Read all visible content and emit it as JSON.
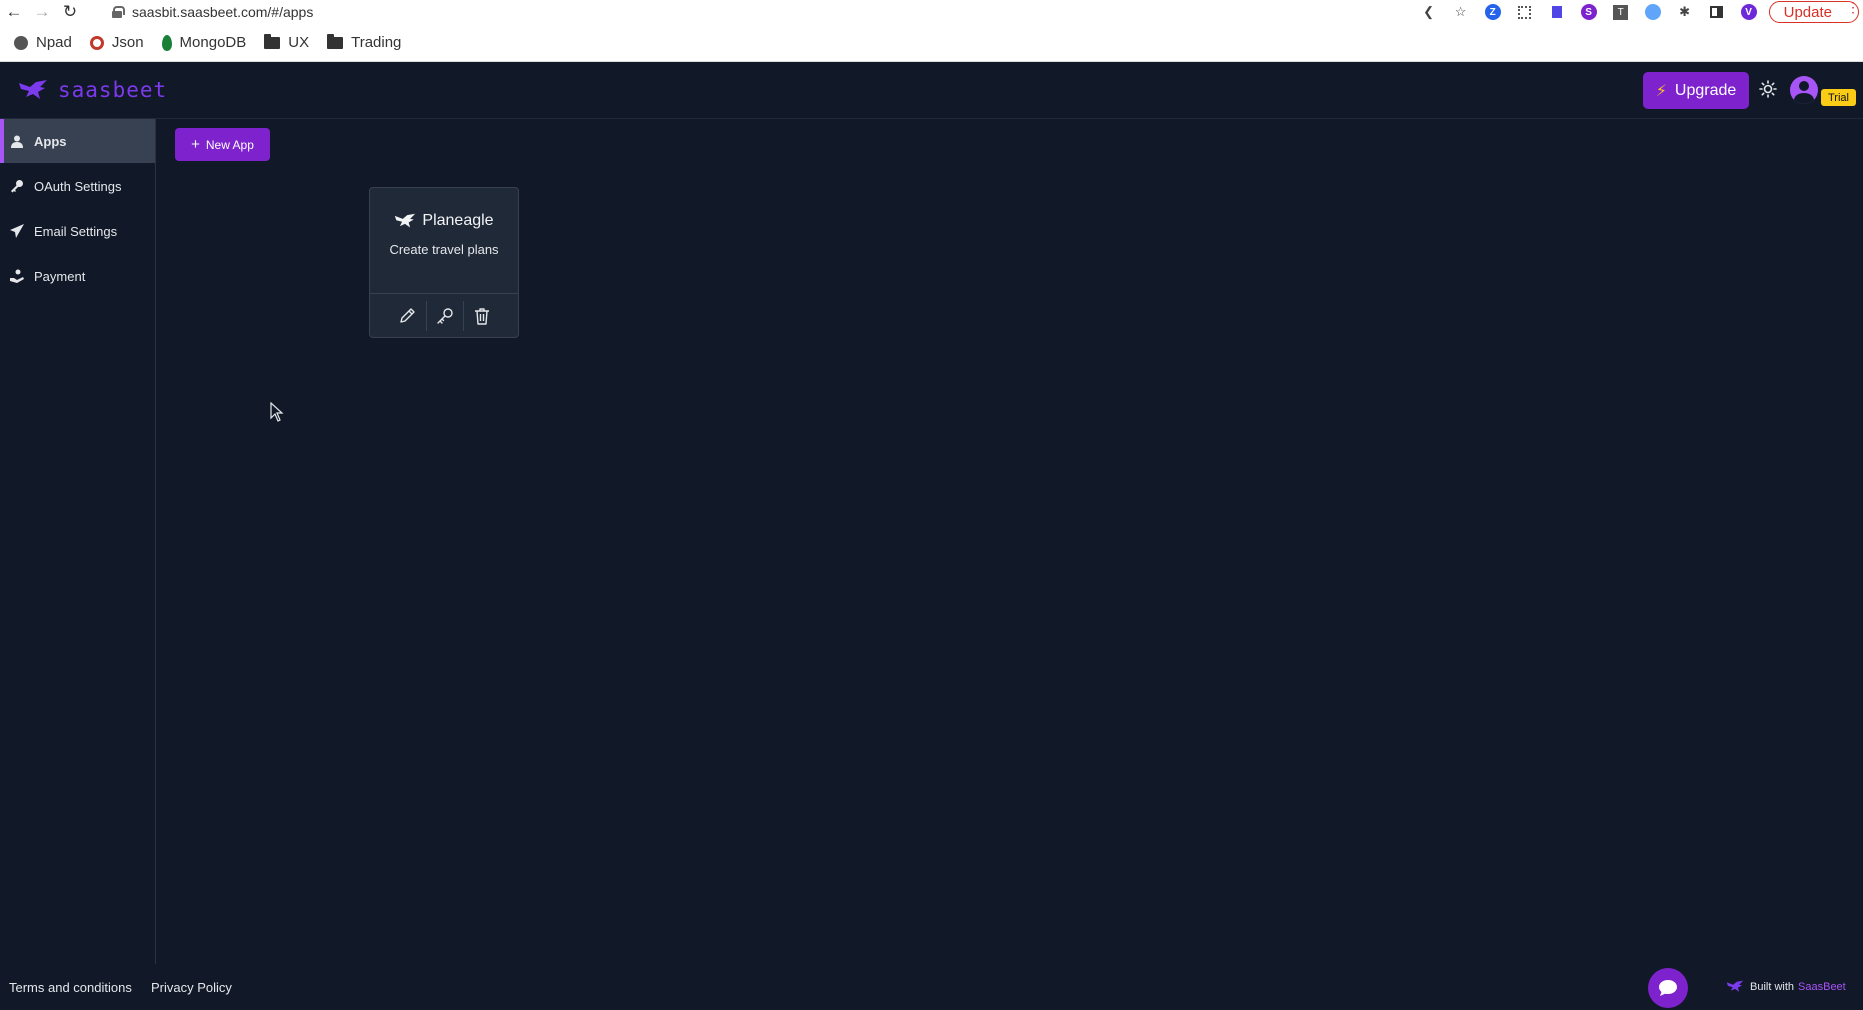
{
  "browser": {
    "url": "saasbit.saasbeet.com/#/apps",
    "update_label": "Update",
    "bookmarks": [
      {
        "label": "Npad",
        "icon": "globe-icon"
      },
      {
        "label": "Json",
        "icon": "json-icon"
      },
      {
        "label": "MongoDB",
        "icon": "mongodb-leaf-icon"
      },
      {
        "label": "UX",
        "icon": "folder-icon"
      },
      {
        "label": "Trading",
        "icon": "folder-icon"
      }
    ],
    "profile_initial": "V"
  },
  "header": {
    "logo_text": "saasbeet",
    "upgrade_label": "Upgrade",
    "trial_badge": "Trial"
  },
  "sidebar": {
    "items": [
      {
        "label": "Apps",
        "icon": "user-icon",
        "active": true
      },
      {
        "label": "OAuth Settings",
        "icon": "key-icon"
      },
      {
        "label": "Email Settings",
        "icon": "paper-plane-icon"
      },
      {
        "label": "Payment",
        "icon": "hand-coin-icon"
      }
    ]
  },
  "main": {
    "new_app_label": "New App",
    "apps": [
      {
        "name": "Planeagle",
        "description": "Create travel plans"
      }
    ]
  },
  "footer": {
    "terms": "Terms and conditions",
    "privacy": "Privacy Policy",
    "built_with": "Built with",
    "brand": "SaasBeet"
  },
  "colors": {
    "accent": "#7e22ce",
    "background": "#111827",
    "card": "#1f2937",
    "trial": "#facc15"
  }
}
